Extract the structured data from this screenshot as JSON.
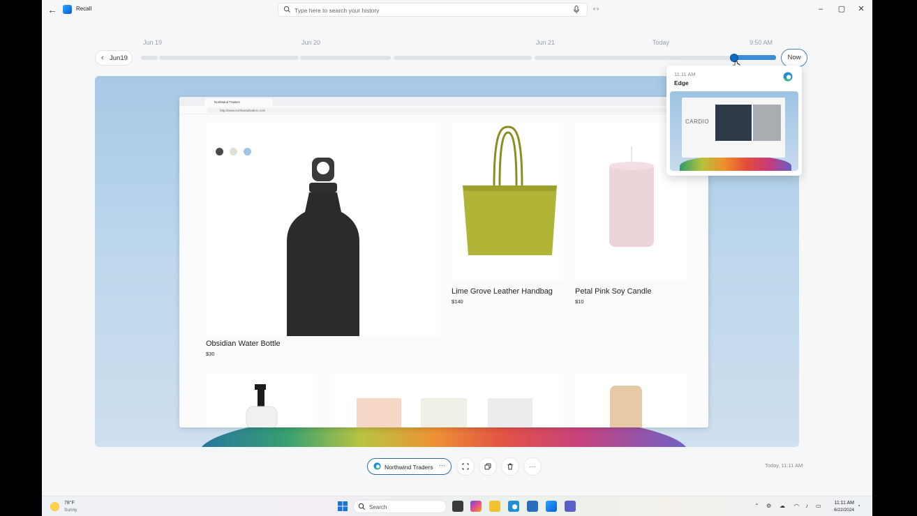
{
  "window": {
    "title": "Recall",
    "search_placeholder": "Type here to search your history",
    "code_icon_text": "‹·›"
  },
  "timeline": {
    "back_label": "Jun19",
    "dates": [
      "Jun 19",
      "Jun 20",
      "Jun 21",
      "Today",
      "9:50 AM"
    ],
    "now_label": "Now"
  },
  "preview": {
    "time": "11:11 AM",
    "app": "Edge",
    "thumb_text": "CARDIO"
  },
  "browser": {
    "tab_title": "Northwind Traders",
    "url": "http://www.northwindtraders.com"
  },
  "products": [
    {
      "name": "Obsidian  Water Bottle",
      "price": "$30"
    },
    {
      "name": "Lime Grove Leather Handbag",
      "price": "$140"
    },
    {
      "name": "Petal Pink Soy Candle",
      "price": "$10"
    }
  ],
  "swatch_colors": [
    "#4a4a4a",
    "#dfe0d6",
    "#9ec3e6"
  ],
  "actions": {
    "app_pill_label": "Northwind Traders",
    "more_label": "···",
    "timestamp": "Today, 11:11 AM"
  },
  "taskbar": {
    "temp": "78°F",
    "condition": "Sunny",
    "search_label": "Search",
    "time": "11:11 AM",
    "date": "6/22/2024"
  }
}
